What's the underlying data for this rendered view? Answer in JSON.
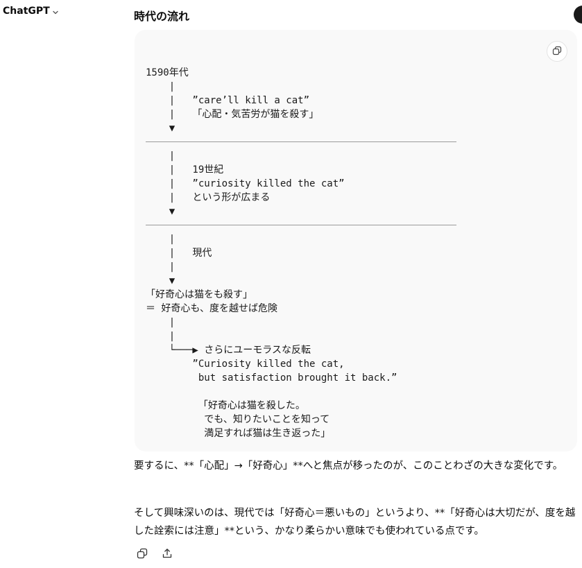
{
  "app": {
    "title": "ChatGPT"
  },
  "response": {
    "heading": "時代の流れ",
    "code_block": {
      "segments": [
        "1590年代\n    |\n    |   ”care’ll kill a cat”\n    |   「心配・気苦労が猫を殺す」\n    ▼",
        "    |\n    |   19世紀\n    |   ”curiosity killed the cat”\n    |   という形が広まる\n    ▼",
        "    |\n    |   現代\n    |\n    ▼\n「好奇心は猫をも殺す」\n＝ 好奇心も、度を越せば危険\n    |\n    |\n    └───▶ さらにユーモラスな反転\n        ”Curiosity killed the cat,\n         but satisfaction brought it back.”\n\n         「好奇心は猫を殺した。\n          でも、知りたいことを知って\n          満足すれば猫は生き返った」"
      ]
    },
    "paragraphs": [
      "要するに、**「心配」→「好奇心」**へと焦点が移ったのが、このことわざの大きな変化です。",
      "そして興味深いのは、現代では「好奇心＝悪いもの」というより、**「好奇心は大切だが、度を越した詮索には注意」**という、かなり柔らかい意味でも使われている点です。"
    ]
  },
  "icons": {
    "model_dropdown": "chevron-down-icon",
    "copy_code": "copy-icon",
    "copy_message": "copy-icon",
    "share": "share-icon"
  }
}
